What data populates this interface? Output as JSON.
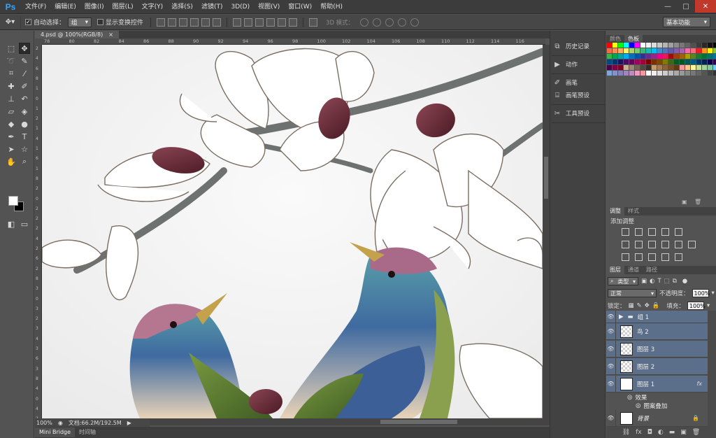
{
  "app": {
    "logo": "Ps"
  },
  "menu": [
    "文件(F)",
    "编辑(E)",
    "图像(I)",
    "图层(L)",
    "文字(Y)",
    "选择(S)",
    "滤镜(T)",
    "3D(D)",
    "视图(V)",
    "窗口(W)",
    "帮助(H)"
  ],
  "window_controls": {
    "minimize": "—",
    "maximize": "□",
    "close": "✕"
  },
  "options": {
    "auto_select_label": "自动选择：",
    "auto_select_value": "组",
    "show_transform_label": "显示变换控件",
    "mode_3d_label": "3D 模式：",
    "workspace": "基本功能"
  },
  "document": {
    "tab_title": "4.psd @ 100%(RGB/8)",
    "tab_close": "×"
  },
  "ruler_top": [
    "78",
    "80",
    "82",
    "84",
    "86",
    "88",
    "90",
    "92",
    "94",
    "96",
    "98",
    "100",
    "102",
    "104",
    "106",
    "108",
    "110",
    "112",
    "114",
    "116"
  ],
  "ruler_left": [
    "2",
    "4",
    "6",
    "8",
    "1",
    "0",
    "1",
    "2",
    "1",
    "4",
    "1",
    "6",
    "1",
    "8",
    "2",
    "0",
    "2",
    "2",
    "2",
    "4",
    "2",
    "6",
    "2",
    "8",
    "3",
    "0",
    "3",
    "2",
    "3",
    "4",
    "3",
    "6",
    "3",
    "8",
    "4",
    "0",
    "4",
    "2"
  ],
  "status": {
    "zoom": "100%",
    "doc_info": "文档:66.2M/192.5M"
  },
  "bottom_tabs": [
    "Mini Bridge",
    "时间轴"
  ],
  "dock": [
    {
      "icon": "history-icon",
      "label": "历史记录"
    },
    {
      "icon": "play-icon",
      "label": "动作"
    },
    {
      "icon": "brush-icon",
      "label": "画笔"
    },
    {
      "icon": "brush-presets-icon",
      "label": "画笔预设"
    },
    {
      "icon": "tool-presets-icon",
      "label": "工具预设"
    }
  ],
  "swatches_panel": {
    "tabs": [
      "颜色",
      "色板"
    ],
    "active": 1
  },
  "adjust_panel": {
    "tabs": [
      "调整",
      "样式"
    ],
    "title": "添加调整"
  },
  "layers_panel": {
    "tabs": [
      "图层",
      "通道",
      "路径"
    ],
    "filter_type": "类型",
    "blend_mode": "正常",
    "opacity_label": "不透明度：",
    "opacity_value": "100%",
    "lock_label": "锁定：",
    "fill_label": "填充：",
    "fill_value": "100%",
    "layers": [
      {
        "name": "组 1",
        "kind": "group",
        "selected": true
      },
      {
        "name": "鸟 2",
        "kind": "layer",
        "selected": true
      },
      {
        "name": "图层 3",
        "kind": "layer",
        "selected": true
      },
      {
        "name": "图层 2",
        "kind": "layer",
        "selected": true
      },
      {
        "name": "图层 1",
        "kind": "layer",
        "selected": true,
        "fx": "fx"
      }
    ],
    "effects_label": "效果",
    "effect_item": "图案叠加",
    "background_layer": "背景"
  },
  "colors": {
    "accent_selected": "#5b6e8a",
    "menu_bg": "#3c3c3c",
    "panel_bg": "#535353",
    "branch": "#6f7371",
    "bud": "#5e2530"
  }
}
